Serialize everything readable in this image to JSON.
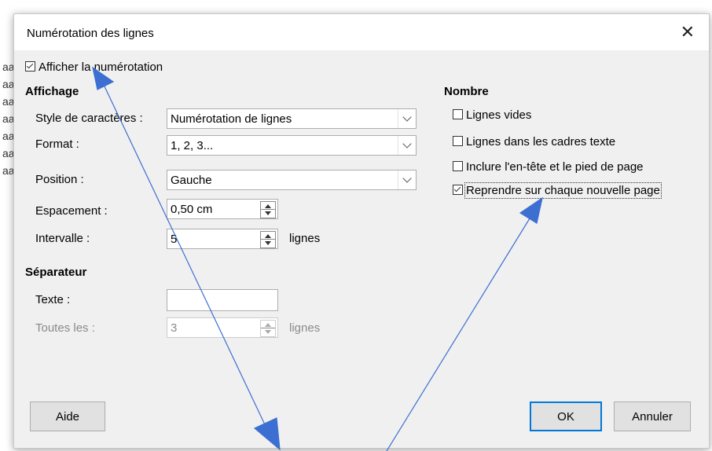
{
  "background_doc": {
    "lines": [
      "aa",
      "aa",
      "aa",
      "aa",
      "aa",
      "aa",
      "aa"
    ]
  },
  "dialog": {
    "title": "Numérotation des lignes",
    "close_symbol": "✕",
    "show_numbering": {
      "label": "Afficher la numérotation",
      "checked": true
    }
  },
  "affichage": {
    "heading": "Affichage",
    "char_style": {
      "label": "Style de caractères :",
      "value": "Numérotation de lignes"
    },
    "format": {
      "label": "Format :",
      "value": "1, 2, 3..."
    },
    "position": {
      "label": "Position :",
      "value": "Gauche"
    },
    "spacing": {
      "label": "Espacement :",
      "value": "0,50 cm"
    },
    "interval": {
      "label": "Intervalle :",
      "value": "5",
      "unit": "lignes"
    }
  },
  "separateur": {
    "heading": "Séparateur",
    "text": {
      "label": "Texte :",
      "value": ""
    },
    "every": {
      "label": "Toutes les :",
      "value": "3",
      "unit": "lignes"
    }
  },
  "nombre": {
    "heading": "Nombre",
    "options": [
      {
        "label": "Lignes vides",
        "checked": false
      },
      {
        "label": "Lignes dans les cadres texte",
        "checked": false
      },
      {
        "label": "Inclure l'en-tête et le pied de page",
        "checked": false
      },
      {
        "label": "Reprendre sur chaque nouvelle page",
        "checked": true
      }
    ]
  },
  "buttons": {
    "help": "Aide",
    "ok": "OK",
    "cancel": "Annuler"
  },
  "colors": {
    "accent": "#0078d7",
    "arrow": "#3c6fd1",
    "dialog_bg": "#f0f0f0"
  }
}
